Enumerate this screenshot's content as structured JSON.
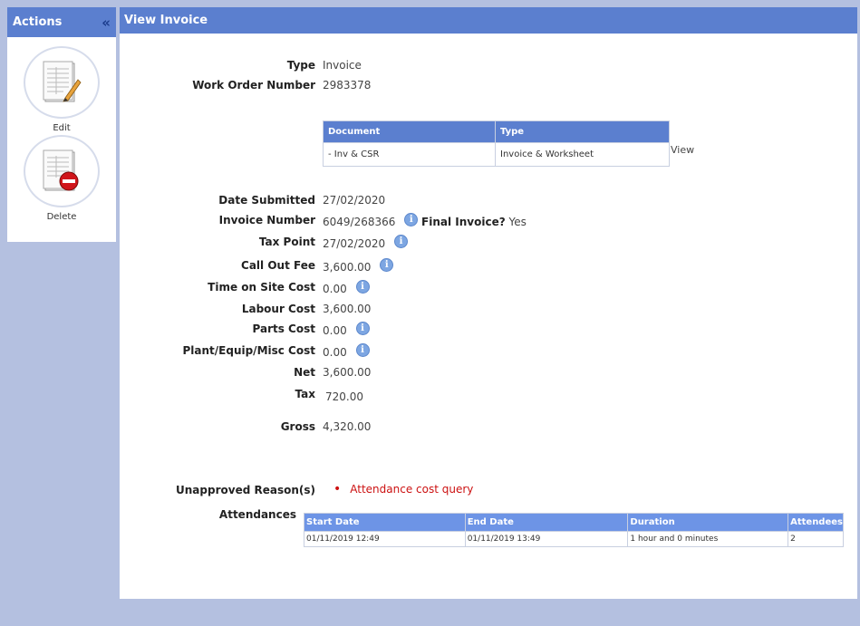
{
  "actions": {
    "title": "Actions",
    "collapse_glyph": "«",
    "edit_label": "Edit",
    "delete_label": "Delete"
  },
  "main": {
    "title": "View Invoice"
  },
  "fields": {
    "type_label": "Type",
    "type_value": "Invoice",
    "work_order_label": "Work Order Number",
    "work_order_value": "2983378",
    "date_submitted_label": "Date Submitted",
    "date_submitted_value": "27/02/2020",
    "invoice_number_label": "Invoice Number",
    "invoice_number_value": "6049/268366",
    "final_invoice_label": "Final Invoice?",
    "final_invoice_value": "Yes",
    "tax_point_label": "Tax Point",
    "tax_point_value": "27/02/2020",
    "call_out_fee_label": "Call Out Fee",
    "call_out_fee_value": "3,600.00",
    "time_on_site_label": "Time on Site Cost",
    "time_on_site_value": "0.00",
    "labour_cost_label": "Labour Cost",
    "labour_cost_value": "3,600.00",
    "parts_cost_label": "Parts Cost",
    "parts_cost_value": "0.00",
    "plant_cost_label": "Plant/Equip/Misc Cost",
    "plant_cost_value": "0.00",
    "net_label": "Net",
    "net_value": "3,600.00",
    "tax_label": "Tax",
    "tax_value": "720.00",
    "gross_label": "Gross",
    "gross_value": "4,320.00",
    "unapproved_label": "Unapproved Reason(s)",
    "unapproved_reason": "Attendance cost query",
    "attendances_label": "Attendances"
  },
  "documents": {
    "headers": [
      "Document",
      "Type"
    ],
    "rows": [
      [
        "- Inv & CSR",
        "Invoice & Worksheet"
      ]
    ],
    "view_label": "View"
  },
  "attendances": {
    "headers": [
      "Start Date",
      "End Date",
      "Duration",
      "Attendees"
    ],
    "rows": [
      [
        "01/11/2019 12:49",
        "01/11/2019 13:49",
        "1 hour and 0 minutes",
        "2"
      ]
    ]
  },
  "icons": {
    "info": "info-icon",
    "edit": "document-edit-icon",
    "delete": "document-delete-icon",
    "info_glyph": "i"
  },
  "colors": {
    "header_blue": "#5b7fcf",
    "background": "#b4c0e0",
    "reason_red": "#cc1111"
  }
}
